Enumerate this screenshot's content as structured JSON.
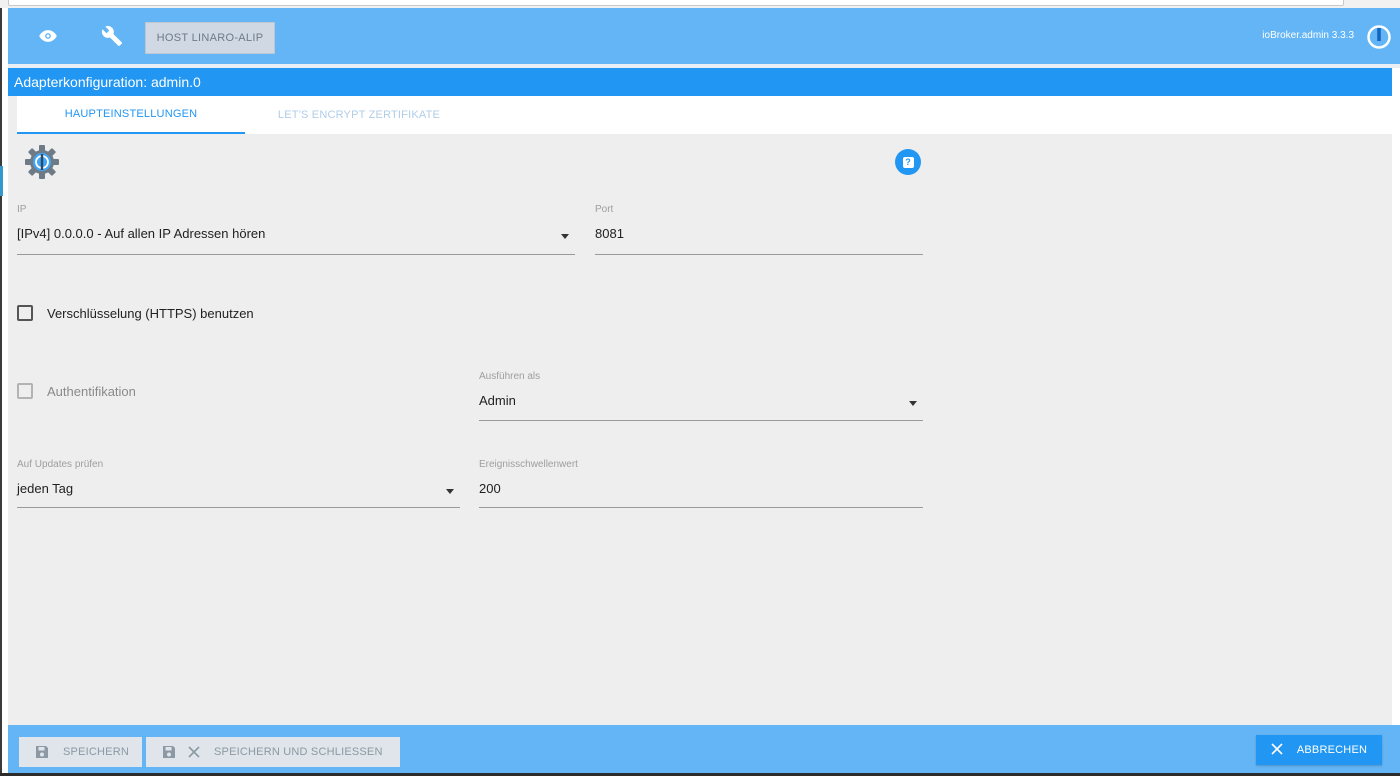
{
  "topbar": {
    "host_button": "HOST LINARO-ALIP",
    "version": "ioBroker.admin 3.3.3",
    "icons": [
      "eye-icon",
      "wrench-icon",
      "power-icon"
    ],
    "color": "#64b5f6"
  },
  "title": "Adapterkonfiguration: admin.0",
  "tabs": [
    {
      "label": "HAUPTEINSTELLUNGEN",
      "active": true
    },
    {
      "label": "LET'S ENCRYPT ZERTIFIKATE",
      "active": false
    }
  ],
  "form": {
    "ip": {
      "label": "IP",
      "value": "[IPv4] 0.0.0.0 - Auf allen IP Adressen hören"
    },
    "port": {
      "label": "Port",
      "value": "8081"
    },
    "https": {
      "label": "Verschlüsselung (HTTPS) benutzen",
      "checked": false
    },
    "auth": {
      "label": "Authentifikation",
      "checked": false,
      "disabled": true
    },
    "run_as": {
      "label": "Ausführen als",
      "value": "Admin"
    },
    "updates": {
      "label": "Auf Updates prüfen",
      "value": "jeden Tag"
    },
    "threshold": {
      "label": "Ereignisschwellenwert",
      "value": "200"
    }
  },
  "footer": {
    "save": "SPEICHERN",
    "save_close": "SPEICHERN UND SCHLIESSEN",
    "cancel": "ABBRECHEN"
  },
  "colors": {
    "accent": "#2196f3",
    "background": "#eeeeee"
  }
}
